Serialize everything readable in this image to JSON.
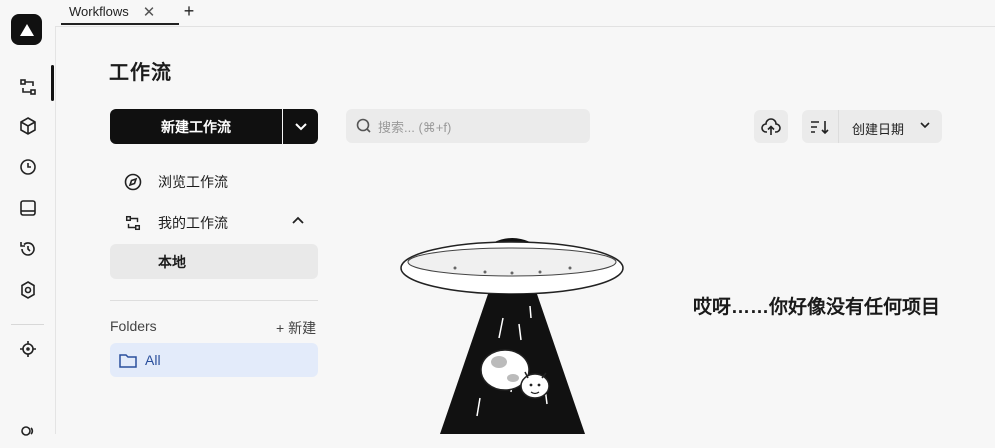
{
  "tabs": {
    "active_label": "Workflows",
    "close_symbol": "✕",
    "add_symbol": "+"
  },
  "page": {
    "title": "工作流"
  },
  "actions": {
    "new_workflow_label": "新建工作流"
  },
  "nav": {
    "browse_label": "浏览工作流",
    "my_workflows_label": "我的工作流",
    "local_label": "本地"
  },
  "folders": {
    "label": "Folders",
    "new_label": "+ 新建",
    "all_label": "All"
  },
  "search": {
    "placeholder": "搜索... (⌘+f)"
  },
  "sort": {
    "label": "创建日期"
  },
  "empty_state": {
    "message": "哎呀……你好像没有任何项目"
  },
  "icons": {
    "rail": [
      "app-logo-icon",
      "workflow-icon",
      "cube-icon",
      "clock-icon",
      "panel-icon",
      "history-icon",
      "settings-icon",
      "target-icon",
      "user-icon"
    ],
    "toolbar": [
      "search-icon",
      "upload-cloud-icon",
      "sort-icon",
      "chevron-down-icon"
    ]
  },
  "colors": {
    "primary": "#101010",
    "selected_folder_bg": "#e3ebfa",
    "selected_folder_text": "#2a4f9c"
  }
}
